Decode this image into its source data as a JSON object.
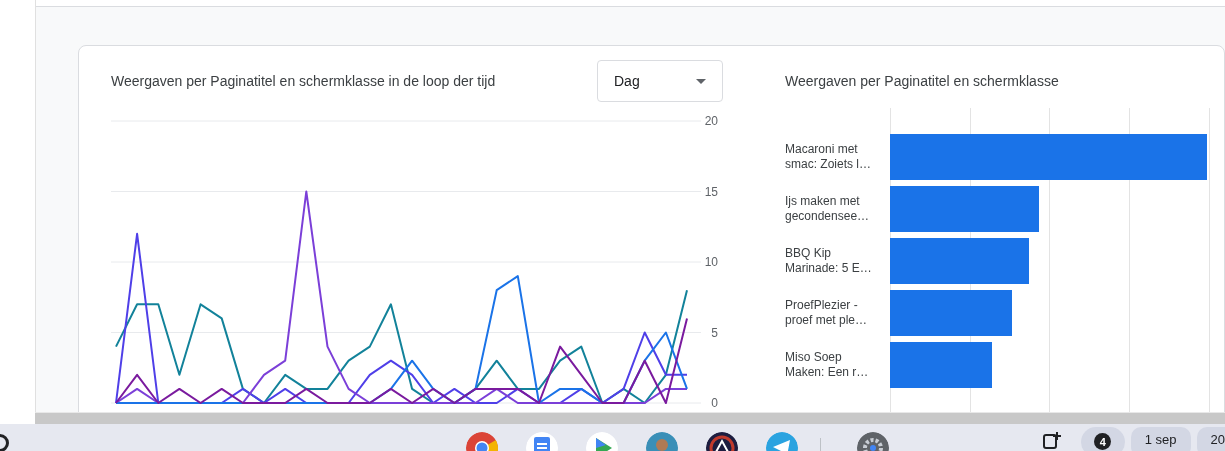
{
  "line_chart_card": {
    "title": "Weergaven per Paginatitel en schermklasse in de loop der tijd",
    "period_dropdown": {
      "value": "Dag"
    },
    "chart_data": {
      "type": "line",
      "grid": true,
      "ylim": [
        0,
        20
      ],
      "yticks": [
        0,
        5,
        10,
        15,
        20
      ],
      "series": [
        {
          "color": "#12829a",
          "values": [
            4,
            7,
            7,
            2,
            7,
            6,
            1,
            0,
            2,
            1,
            1,
            3,
            4,
            7,
            1,
            0,
            0,
            1,
            3,
            1,
            1,
            3,
            4,
            0,
            1,
            0,
            2,
            8
          ]
        },
        {
          "color": "#4f3fe8",
          "values": [
            0,
            12,
            0,
            0,
            0,
            0,
            1,
            0,
            1,
            0,
            0,
            0,
            2,
            3,
            2,
            0,
            1,
            0,
            0,
            1,
            0,
            0,
            1,
            0,
            1,
            5,
            2,
            2
          ]
        },
        {
          "color": "#7b3fd8",
          "values": [
            0,
            1,
            0,
            0,
            0,
            0,
            0,
            2,
            3,
            15,
            4,
            1,
            0,
            0,
            0,
            0,
            0,
            0,
            1,
            0,
            0,
            0,
            0,
            0,
            0,
            0,
            1,
            1
          ]
        },
        {
          "color": "#1a73e8",
          "values": [
            0,
            0,
            0,
            0,
            0,
            0,
            0,
            0,
            0,
            0,
            0,
            0,
            0,
            1,
            3,
            1,
            0,
            1,
            8,
            9,
            0,
            1,
            1,
            0,
            0,
            3,
            5,
            1
          ]
        },
        {
          "color": "#7a1a9e",
          "values": [
            0,
            2,
            0,
            1,
            0,
            1,
            0,
            0,
            0,
            1,
            0,
            0,
            0,
            1,
            0,
            1,
            0,
            1,
            1,
            1,
            0,
            4,
            2,
            0,
            0,
            3,
            0,
            6
          ]
        }
      ]
    }
  },
  "bar_chart_card": {
    "title": "Weergaven per Paginatitel en schermklasse",
    "bars": [
      {
        "label": "Macaroni met smac: Zoiets l…",
        "level": 0.96
      },
      {
        "label": "Ijs maken met gecondensee…",
        "level": 0.45
      },
      {
        "label": "BBQ Kip Marinade: 5 E…",
        "level": 0.42
      },
      {
        "label": "ProefPlezier - proef met ple…",
        "level": 0.37
      },
      {
        "label": "Miso Soep Maken: Een r…",
        "level": 0.31
      }
    ]
  },
  "taskbar": {
    "apps": [
      {
        "kind": "browser"
      },
      {
        "kind": "docs"
      },
      {
        "kind": "play"
      },
      {
        "kind": "avatar"
      },
      {
        "kind": "badge"
      },
      {
        "kind": "telegram"
      },
      {
        "kind": "settings"
      }
    ],
    "notification_count": "4",
    "date": "1 sep",
    "time": "20"
  }
}
